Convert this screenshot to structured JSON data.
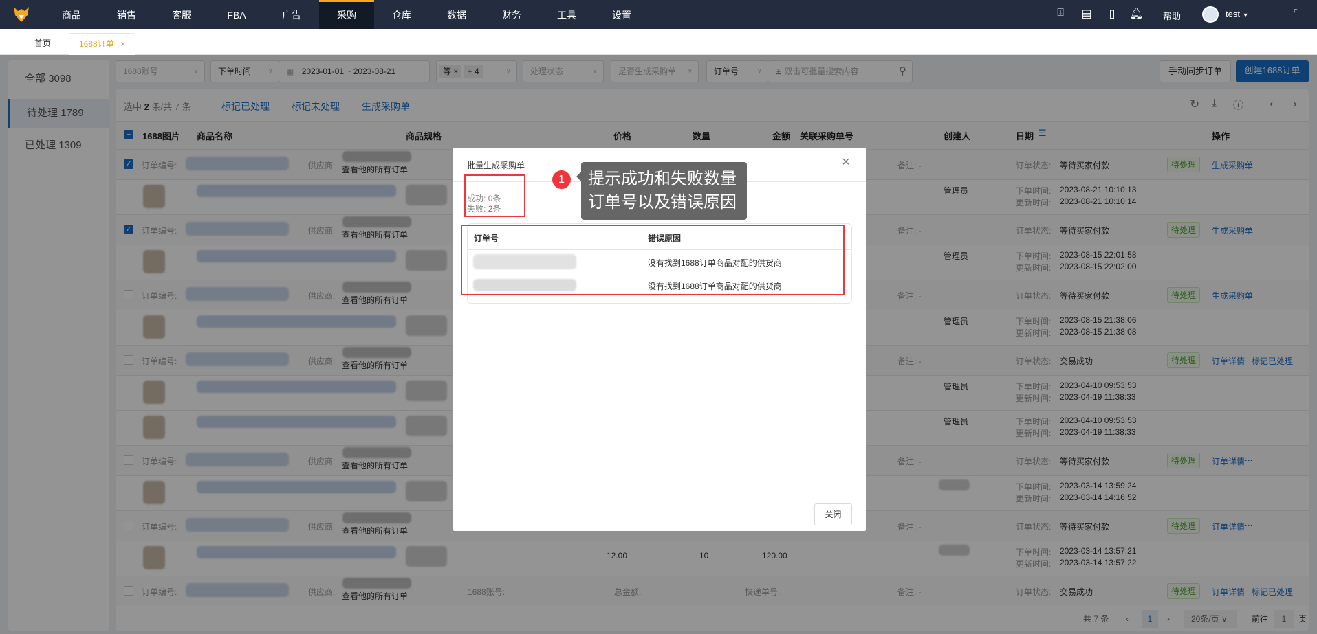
{
  "nav": {
    "items": [
      "商品",
      "销售",
      "客服",
      "FBA",
      "广告",
      "采购",
      "仓库",
      "数据",
      "财务",
      "工具",
      "设置"
    ],
    "active": 5,
    "help": "帮助",
    "user": "test",
    "icons": [
      "download-icon",
      "document-add-icon",
      "mobile-icon",
      "bell-icon"
    ]
  },
  "tabs": [
    {
      "label": "首页"
    },
    {
      "label": "1688订单",
      "close": "×"
    }
  ],
  "sidebar": {
    "items": [
      {
        "label": "全部",
        "count": "3098"
      },
      {
        "label": "待处理",
        "count": "1789"
      },
      {
        "label": "已处理",
        "count": "1309"
      }
    ],
    "active": 1
  },
  "filters": {
    "account_placeholder": "1688账号",
    "time_type": "下单时间",
    "date_range": "2023-01-01  ~  2023-08-21",
    "tag1": "等",
    "tag1_close": "×",
    "tag_more": "+ 4",
    "status_placeholder": "处理状态",
    "generated_placeholder": "是否生成采购单",
    "search_field": "订单号",
    "search_placeholder": "双击可批量搜索内容",
    "sync_button": "手动同步订单",
    "create_button": "创建1688订单"
  },
  "toolbar": {
    "selected_prefix": "选中",
    "selected": "2",
    "selected_mid": "条/共",
    "total": "7",
    "selected_suffix": "条",
    "mark_processed": "标记已处理",
    "mark_unprocessed": "标记未处理",
    "generate": "生成采购单"
  },
  "columns": [
    "1688图片",
    "商品名称",
    "商品规格",
    "价格",
    "数量",
    "金额",
    "关联采购单号",
    "创建人",
    "日期",
    "操作"
  ],
  "labels": {
    "order_no": "订单编号:",
    "supplier": "供应商:",
    "view_all": "查看他的所有订单",
    "remark": "备注:",
    "remark_val": "-",
    "status": "订单状态:",
    "order_time": "下单时间:",
    "update_time": "更新时间:",
    "account": "1688账号:",
    "total_amount": "总金额:",
    "express": "快递单号:"
  },
  "orders": [
    {
      "checked": true,
      "status": "等待买家付款",
      "tag": "待处理",
      "actions": [
        "生成采购单",
        "···"
      ],
      "subs": [
        {
          "creator": "管理员",
          "order_time": "2023-08-21 10:10:13",
          "update_time": "2023-08-21 10:10:14"
        }
      ]
    },
    {
      "checked": true,
      "status": "等待买家付款",
      "tag": "待处理",
      "actions": [
        "生成采购单",
        "···"
      ],
      "subs": [
        {
          "creator": "管理员",
          "order_time": "2023-08-15 22:01:58",
          "update_time": "2023-08-15 22:02:00"
        }
      ]
    },
    {
      "checked": false,
      "status": "等待买家付款",
      "tag": "待处理",
      "actions": [
        "生成采购单",
        "···"
      ],
      "subs": [
        {
          "creator": "管理员",
          "order_time": "2023-08-15 21:38:06",
          "update_time": "2023-08-15 21:38:08"
        }
      ]
    },
    {
      "checked": false,
      "status": "交易成功",
      "tag": "待处理",
      "actions": [
        "订单详情",
        "标记已处理"
      ],
      "subs": [
        {
          "creator": "管理员",
          "order_time": "2023-04-10 09:53:53",
          "update_time": "2023-04-19 11:38:33"
        },
        {
          "creator": "管理员",
          "order_time": "2023-04-10 09:53:53",
          "update_time": "2023-04-19 11:38:33"
        }
      ]
    },
    {
      "checked": false,
      "status": "等待买家付款",
      "tag": "待处理",
      "actions": [
        "订单详情",
        "···"
      ],
      "subs": [
        {
          "creator": "",
          "order_time": "2023-03-14 13:59:24",
          "update_time": "2023-03-14 14:16:52"
        }
      ]
    },
    {
      "checked": false,
      "status": "等待买家付款",
      "tag": "待处理",
      "actions": [
        "订单详情",
        "···"
      ],
      "subs": [
        {
          "creator": "",
          "order_time": "2023-03-14 13:57:21",
          "update_time": "2023-03-14 13:57:22",
          "price": "12.00",
          "qty": "10",
          "amount": "120.00"
        }
      ]
    },
    {
      "checked": false,
      "status": "交易成功",
      "tag": "待处理",
      "actions": [
        "订单详情",
        "标记已处理"
      ],
      "extra": true,
      "subs": []
    }
  ],
  "pagination": {
    "total_prefix": "共",
    "total": "7",
    "total_suffix": "条",
    "current": "1",
    "page_size": "20条/页",
    "goto": "前往",
    "goto_val": "1",
    "page_suffix": "页"
  },
  "modal": {
    "title": "批量生成采购单",
    "success_label": "成功:",
    "success_count": "0",
    "fail_label": "失败:",
    "fail_count": "2",
    "unit": "条",
    "col_order": "订单号",
    "col_reason": "错误原因",
    "errors": [
      {
        "reason": "没有找到1688订单商品对配的供货商"
      },
      {
        "reason": "没有找到1688订单商品对配的供货商"
      }
    ],
    "close_button": "关闭"
  },
  "annotation": {
    "number": "1",
    "line1": "提示成功和失败数量",
    "line2": "订单号以及错误原因"
  },
  "colors": {
    "accent": "#1a6fc9",
    "nav": "#232d3f",
    "warn": "#f0353d",
    "orange": "#f5a623"
  }
}
